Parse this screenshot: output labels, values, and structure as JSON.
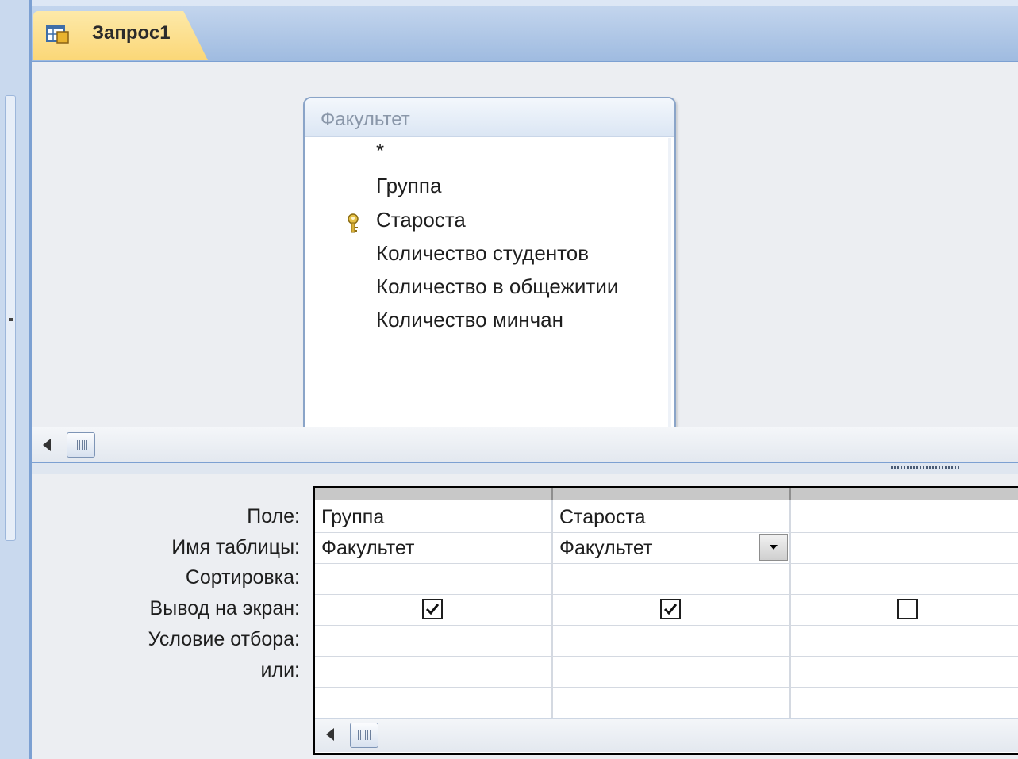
{
  "tab": {
    "title": "Запрос1",
    "icon": "query-table-icon"
  },
  "table_box": {
    "title": "Факультет",
    "fields": [
      "*",
      "Группа",
      "Староста",
      "Количество студентов",
      "Количество в общежитии",
      "Количество минчан"
    ],
    "key_field_icon": "primary-key-icon"
  },
  "grid": {
    "row_labels": [
      "Поле:",
      "Имя таблицы:",
      "Сортировка:",
      "Вывод на экран:",
      "Условие отбора:",
      "или:"
    ],
    "columns": [
      {
        "field": "Группа",
        "table": "Факультет",
        "sort": "",
        "show": true,
        "criteria": "",
        "or": ""
      },
      {
        "field": "Староста",
        "table": "Факультет",
        "sort": "",
        "show": true,
        "criteria": "",
        "or": ""
      },
      {
        "field": "",
        "table": "",
        "sort": "",
        "show": false,
        "criteria": "",
        "or": ""
      }
    ]
  },
  "colors": {
    "accent_tab": "#fbd777",
    "frame_blue": "#7ca0d2",
    "pane_bg": "#eceef2"
  }
}
